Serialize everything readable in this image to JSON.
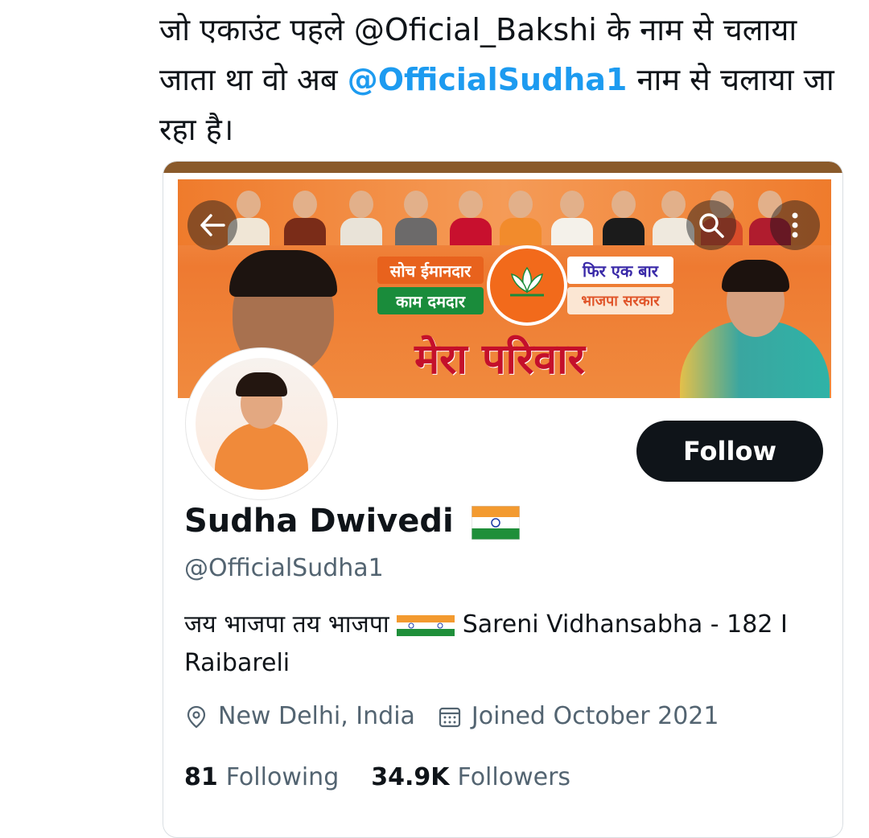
{
  "tweet": {
    "text_before": "जो एकाउंट पहले @Oficial_Bakshi के नाम से चलाया जाता था वो अब ",
    "mention": "@OfficialSudha1",
    "text_after": " नाम से चलाया जा रहा है।"
  },
  "banner": {
    "slogan_left_top": "सोच ईमानदार",
    "slogan_left_bottom": "काम दमदार",
    "slogan_right_top": "फिर एक बार",
    "slogan_right_bottom": "भाजपा सरकार",
    "title": "मेरा परिवार"
  },
  "profile": {
    "follow_label": "Follow",
    "display_name": "Sudha Dwivedi",
    "handle": "@OfficialSudha1",
    "bio_part1": "जय भाजपा तय भाजपा ",
    "bio_part2": " Sareni Vidhansabha - 182 I Raibareli",
    "location": "New Delhi, India",
    "joined": "Joined October 2021",
    "following_count": "81",
    "following_label": "Following",
    "followers_count": "34.9K",
    "followers_label": "Followers"
  },
  "icons": {
    "back": "back-arrow-icon",
    "search": "search-icon",
    "more": "more-vertical-icon",
    "location": "location-pin-icon",
    "calendar": "calendar-icon"
  },
  "colors": {
    "mention": "#1d9bf0",
    "follow_bg": "#0f1419",
    "secondary_text": "#536471",
    "banner_orange": "#ee7a31"
  }
}
